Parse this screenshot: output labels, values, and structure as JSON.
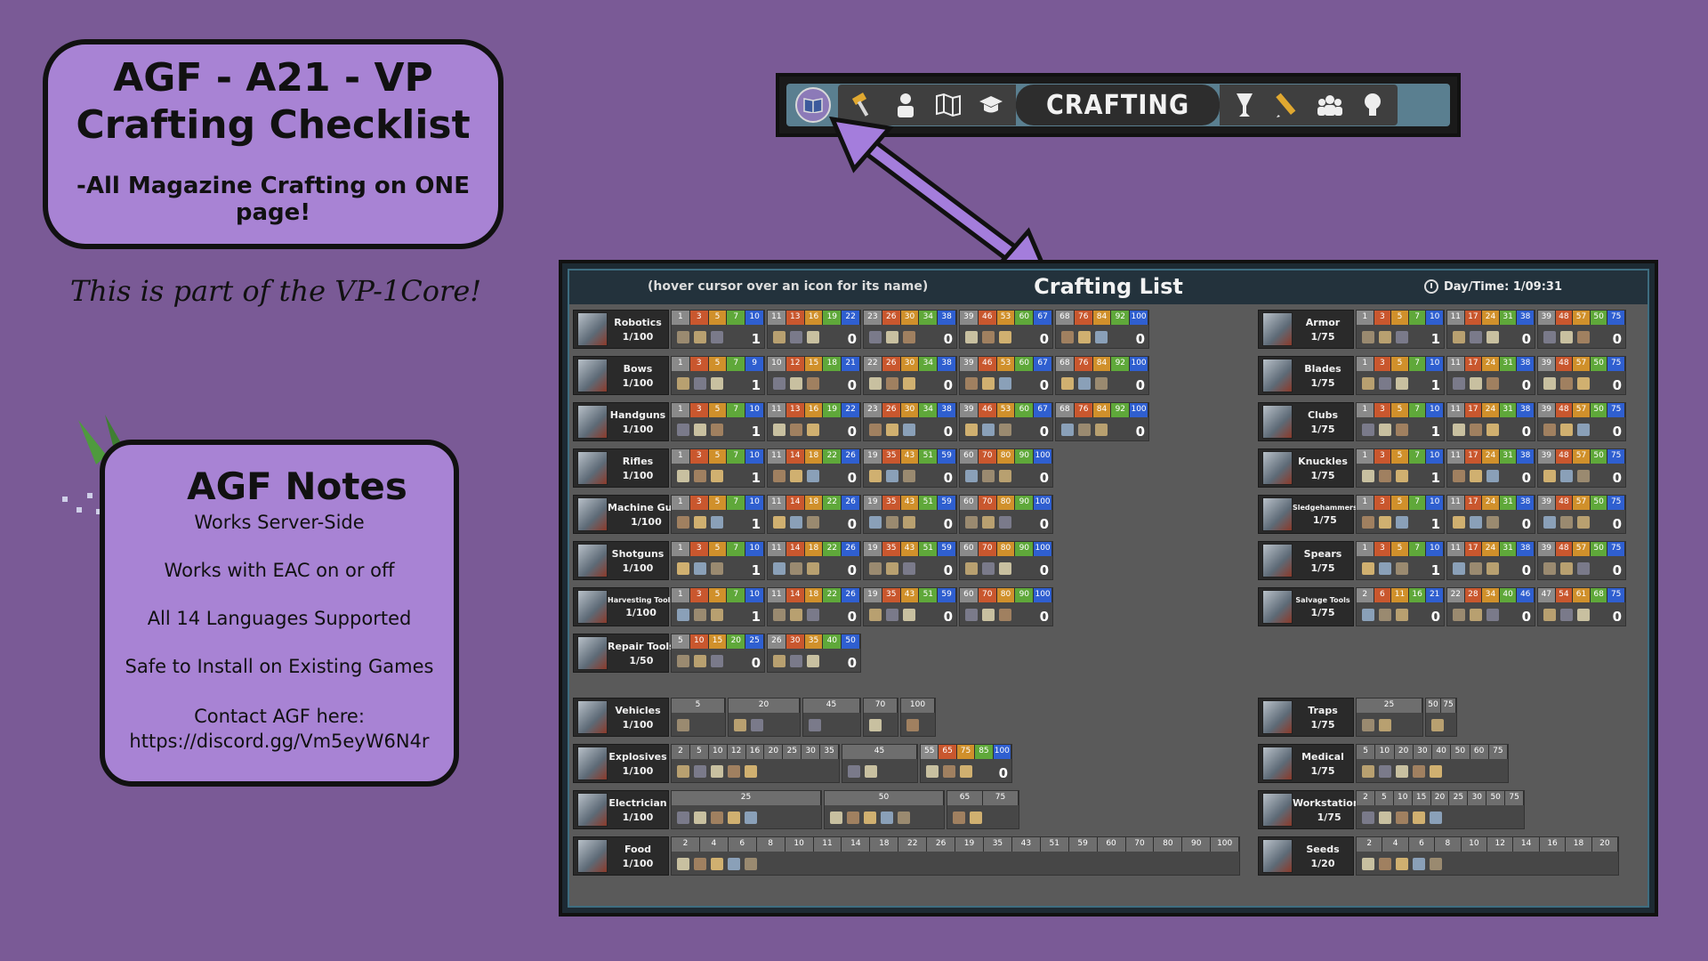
{
  "title_card": {
    "line1": "AGF - A21 - VP",
    "line2": "Crafting Checklist",
    "line3": "-All Magazine Crafting on ONE page!"
  },
  "subtitle": "This is part of the VP-1Core!",
  "notes": {
    "heading": "AGF Notes",
    "lines": [
      "Works Server-Side",
      "Works with EAC on or off",
      "All 14 Languages Supported",
      "Safe to Install on Existing Games"
    ],
    "contact_label": "Contact AGF here:",
    "contact_url": "https://discord.gg/Vm5eyW6N4r"
  },
  "toolbar": {
    "active_label": "CRAFTING",
    "left_icons": [
      "book-icon",
      "hammer-icon",
      "character-icon",
      "map-icon",
      "graduation-cap-icon"
    ],
    "right_icons": [
      "trophy-icon",
      "pencil-icon",
      "players-icon",
      "lightbulb-icon"
    ]
  },
  "panel": {
    "hint": "(hover cursor over an icon for its name)",
    "title": "Crafting List",
    "daytime_label": "Day/Time: 1/09:31"
  },
  "left_rows": [
    {
      "name": "Robotics",
      "count": "1/100",
      "groups": [
        {
          "ticks": [
            "1",
            "3",
            "5",
            "7",
            "10"
          ],
          "lvl": "1"
        },
        {
          "ticks": [
            "11",
            "13",
            "16",
            "19",
            "22"
          ],
          "lvl": "0"
        },
        {
          "ticks": [
            "23",
            "26",
            "30",
            "34",
            "38"
          ],
          "lvl": "0"
        },
        {
          "ticks": [
            "39",
            "46",
            "53",
            "60",
            "67"
          ],
          "lvl": "0"
        },
        {
          "ticks": [
            "68",
            "76",
            "84",
            "92",
            "100"
          ],
          "lvl": "0"
        }
      ]
    },
    {
      "name": "Bows",
      "count": "1/100",
      "groups": [
        {
          "ticks": [
            "1",
            "3",
            "5",
            "7",
            "9"
          ],
          "lvl": "1"
        },
        {
          "ticks": [
            "10",
            "12",
            "15",
            "18",
            "21"
          ],
          "lvl": "0"
        },
        {
          "ticks": [
            "22",
            "26",
            "30",
            "34",
            "38"
          ],
          "lvl": "0"
        },
        {
          "ticks": [
            "39",
            "46",
            "53",
            "60",
            "67"
          ],
          "lvl": "0"
        },
        {
          "ticks": [
            "68",
            "76",
            "84",
            "92",
            "100"
          ],
          "lvl": "0"
        }
      ]
    },
    {
      "name": "Handguns",
      "count": "1/100",
      "groups": [
        {
          "ticks": [
            "1",
            "3",
            "5",
            "7",
            "10"
          ],
          "lvl": "1"
        },
        {
          "ticks": [
            "11",
            "13",
            "16",
            "19",
            "22"
          ],
          "lvl": "0"
        },
        {
          "ticks": [
            "23",
            "26",
            "30",
            "34",
            "38"
          ],
          "lvl": "0"
        },
        {
          "ticks": [
            "39",
            "46",
            "53",
            "60",
            "67"
          ],
          "lvl": "0"
        },
        {
          "ticks": [
            "68",
            "76",
            "84",
            "92",
            "100"
          ],
          "lvl": "0"
        }
      ]
    },
    {
      "name": "Rifles",
      "count": "1/100",
      "groups": [
        {
          "ticks": [
            "1",
            "3",
            "5",
            "7",
            "10"
          ],
          "lvl": "1"
        },
        {
          "ticks": [
            "11",
            "14",
            "18",
            "22",
            "26"
          ],
          "lvl": "0"
        },
        {
          "ticks": [
            "19",
            "35",
            "43",
            "51",
            "59"
          ],
          "lvl": "0"
        },
        {
          "ticks": [
            "60",
            "70",
            "80",
            "90",
            "100"
          ],
          "lvl": "0"
        }
      ]
    },
    {
      "name": "Machine Guns",
      "count": "1/100",
      "groups": [
        {
          "ticks": [
            "1",
            "3",
            "5",
            "7",
            "10"
          ],
          "lvl": "1"
        },
        {
          "ticks": [
            "11",
            "14",
            "18",
            "22",
            "26"
          ],
          "lvl": "0"
        },
        {
          "ticks": [
            "19",
            "35",
            "43",
            "51",
            "59"
          ],
          "lvl": "0"
        },
        {
          "ticks": [
            "60",
            "70",
            "80",
            "90",
            "100"
          ],
          "lvl": "0"
        }
      ]
    },
    {
      "name": "Shotguns",
      "count": "1/100",
      "groups": [
        {
          "ticks": [
            "1",
            "3",
            "5",
            "7",
            "10"
          ],
          "lvl": "1"
        },
        {
          "ticks": [
            "11",
            "14",
            "18",
            "22",
            "26"
          ],
          "lvl": "0"
        },
        {
          "ticks": [
            "19",
            "35",
            "43",
            "51",
            "59"
          ],
          "lvl": "0"
        },
        {
          "ticks": [
            "60",
            "70",
            "80",
            "90",
            "100"
          ],
          "lvl": "0"
        }
      ]
    },
    {
      "name": "Harvesting Tools",
      "count": "1/100",
      "groups": [
        {
          "ticks": [
            "1",
            "3",
            "5",
            "7",
            "10"
          ],
          "lvl": "1"
        },
        {
          "ticks": [
            "11",
            "14",
            "18",
            "22",
            "26"
          ],
          "lvl": "0"
        },
        {
          "ticks": [
            "19",
            "35",
            "43",
            "51",
            "59"
          ],
          "lvl": "0"
        },
        {
          "ticks": [
            "60",
            "70",
            "80",
            "90",
            "100"
          ],
          "lvl": "0"
        }
      ]
    },
    {
      "name": "Repair Tools",
      "count": "1/50",
      "groups": [
        {
          "ticks": [
            "5",
            "10",
            "15",
            "20",
            "25"
          ],
          "lvl": "0"
        },
        {
          "ticks": [
            "26",
            "30",
            "35",
            "40",
            "50"
          ],
          "lvl": "0"
        }
      ]
    }
  ],
  "right_rows": [
    {
      "name": "Armor",
      "count": "1/75",
      "groups": [
        {
          "ticks": [
            "1",
            "3",
            "5",
            "7",
            "10"
          ],
          "lvl": "1"
        },
        {
          "ticks": [
            "11",
            "17",
            "24",
            "31",
            "38"
          ],
          "lvl": "0"
        },
        {
          "ticks": [
            "39",
            "48",
            "57",
            "50",
            "75"
          ],
          "lvl": "0"
        }
      ]
    },
    {
      "name": "Blades",
      "count": "1/75",
      "groups": [
        {
          "ticks": [
            "1",
            "3",
            "5",
            "7",
            "10"
          ],
          "lvl": "1"
        },
        {
          "ticks": [
            "11",
            "17",
            "24",
            "31",
            "38"
          ],
          "lvl": "0"
        },
        {
          "ticks": [
            "39",
            "48",
            "57",
            "50",
            "75"
          ],
          "lvl": "0"
        }
      ]
    },
    {
      "name": "Clubs",
      "count": "1/75",
      "groups": [
        {
          "ticks": [
            "1",
            "3",
            "5",
            "7",
            "10"
          ],
          "lvl": "1"
        },
        {
          "ticks": [
            "11",
            "17",
            "24",
            "31",
            "38"
          ],
          "lvl": "0"
        },
        {
          "ticks": [
            "39",
            "48",
            "57",
            "50",
            "75"
          ],
          "lvl": "0"
        }
      ]
    },
    {
      "name": "Knuckles",
      "count": "1/75",
      "groups": [
        {
          "ticks": [
            "1",
            "3",
            "5",
            "7",
            "10"
          ],
          "lvl": "1"
        },
        {
          "ticks": [
            "11",
            "17",
            "24",
            "31",
            "38"
          ],
          "lvl": "0"
        },
        {
          "ticks": [
            "39",
            "48",
            "57",
            "50",
            "75"
          ],
          "lvl": "0"
        }
      ]
    },
    {
      "name": "Sledgehammers",
      "count": "1/75",
      "groups": [
        {
          "ticks": [
            "1",
            "3",
            "5",
            "7",
            "10"
          ],
          "lvl": "1"
        },
        {
          "ticks": [
            "11",
            "17",
            "24",
            "31",
            "38"
          ],
          "lvl": "0"
        },
        {
          "ticks": [
            "39",
            "48",
            "57",
            "50",
            "75"
          ],
          "lvl": "0"
        }
      ]
    },
    {
      "name": "Spears",
      "count": "1/75",
      "groups": [
        {
          "ticks": [
            "1",
            "3",
            "5",
            "7",
            "10"
          ],
          "lvl": "1"
        },
        {
          "ticks": [
            "11",
            "17",
            "24",
            "31",
            "38"
          ],
          "lvl": "0"
        },
        {
          "ticks": [
            "39",
            "48",
            "57",
            "50",
            "75"
          ],
          "lvl": "0"
        }
      ]
    },
    {
      "name": "Salvage Tools",
      "count": "1/75",
      "groups": [
        {
          "ticks": [
            "2",
            "6",
            "11",
            "16",
            "21"
          ],
          "lvl": "0"
        },
        {
          "ticks": [
            "22",
            "28",
            "34",
            "40",
            "46"
          ],
          "lvl": "0"
        },
        {
          "ticks": [
            "47",
            "54",
            "61",
            "68",
            "75"
          ],
          "lvl": "0"
        }
      ]
    }
  ],
  "bottom_left_rows": [
    {
      "name": "Vehicles",
      "count": "1/100",
      "groups": [
        {
          "ticks": [
            "5"
          ],
          "w": 62
        },
        {
          "ticks": [
            "20"
          ],
          "w": 82
        },
        {
          "ticks": [
            "45"
          ],
          "w": 66
        },
        {
          "ticks": [
            "70"
          ],
          "w": 40
        },
        {
          "ticks": [
            "100"
          ],
          "w": 40
        }
      ]
    },
    {
      "name": "Explosives",
      "count": "1/100",
      "groups": [
        {
          "ticks": [
            "2",
            "5",
            "10",
            "12",
            "16",
            "20",
            "25",
            "30",
            "35"
          ],
          "w": 190
        },
        {
          "ticks": [
            "45"
          ],
          "w": 86
        },
        {
          "ticks": [
            "55",
            "65",
            "75",
            "85",
            "100"
          ],
          "w": 104,
          "lvl": "0"
        }
      ]
    },
    {
      "name": "Electrician",
      "count": "1/100",
      "groups": [
        {
          "ticks": [
            "25"
          ],
          "w": 170
        },
        {
          "ticks": [
            "50"
          ],
          "w": 136
        },
        {
          "ticks": [
            "65",
            "75"
          ],
          "w": 82
        }
      ]
    },
    {
      "name": "Food",
      "count": "1/100",
      "groups": [
        {
          "ticks": [
            "2",
            "4",
            "6",
            "8",
            "10",
            "11",
            "14",
            "18",
            "22",
            "26",
            "19",
            "35",
            "43",
            "51",
            "59",
            "60",
            "70",
            "80",
            "90",
            "100"
          ],
          "w": 640
        }
      ]
    }
  ],
  "bottom_right_rows": [
    {
      "name": "Traps",
      "count": "1/75",
      "groups": [
        {
          "ticks": [
            "25"
          ],
          "w": 76
        },
        {
          "ticks": [
            "50",
            "75"
          ],
          "w": 36
        }
      ]
    },
    {
      "name": "Medical",
      "count": "1/75",
      "groups": [
        {
          "ticks": [
            "5",
            "10",
            "20",
            "30",
            "40",
            "50",
            "60",
            "75"
          ],
          "w": 172
        }
      ]
    },
    {
      "name": "Workstations",
      "count": "1/75",
      "groups": [
        {
          "ticks": [
            "2",
            "5",
            "10",
            "15",
            "20",
            "25",
            "30",
            "50",
            "75"
          ],
          "w": 190
        }
      ]
    },
    {
      "name": "Seeds",
      "count": "1/20",
      "groups": [
        {
          "ticks": [
            "2",
            "4",
            "6",
            "8",
            "10",
            "12",
            "14",
            "16",
            "18",
            "20"
          ],
          "w": 296
        }
      ]
    }
  ]
}
